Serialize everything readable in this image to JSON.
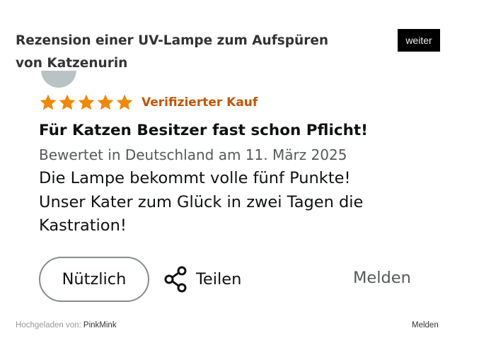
{
  "post": {
    "title": "Rezension einer UV-Lampe zum Aufspüren von Katzenurin",
    "next_label": "weiter"
  },
  "review": {
    "rating": 5,
    "rating_max": 5,
    "star_color": "#f08804",
    "badge": "Verifizierter Kauf",
    "badge_color": "#c45500",
    "title": "Für Katzen Besitzer fast schon Pflicht!",
    "meta": "Bewertet in Deutschland am 11. März 2025",
    "body_lines": [
      "Die Lampe bekommt volle fünf Punkte!",
      "Unser Kater zum Glück in zwei Tagen die",
      "Kastration!"
    ],
    "helpful_label": "Nützlich",
    "share_label": "Teilen",
    "share_icon": "share-icon",
    "report_label": "Melden"
  },
  "footer": {
    "uploaded_prefix": "Hochgeladen von:",
    "uploader": "PinkMink",
    "report_label": "Melden"
  }
}
